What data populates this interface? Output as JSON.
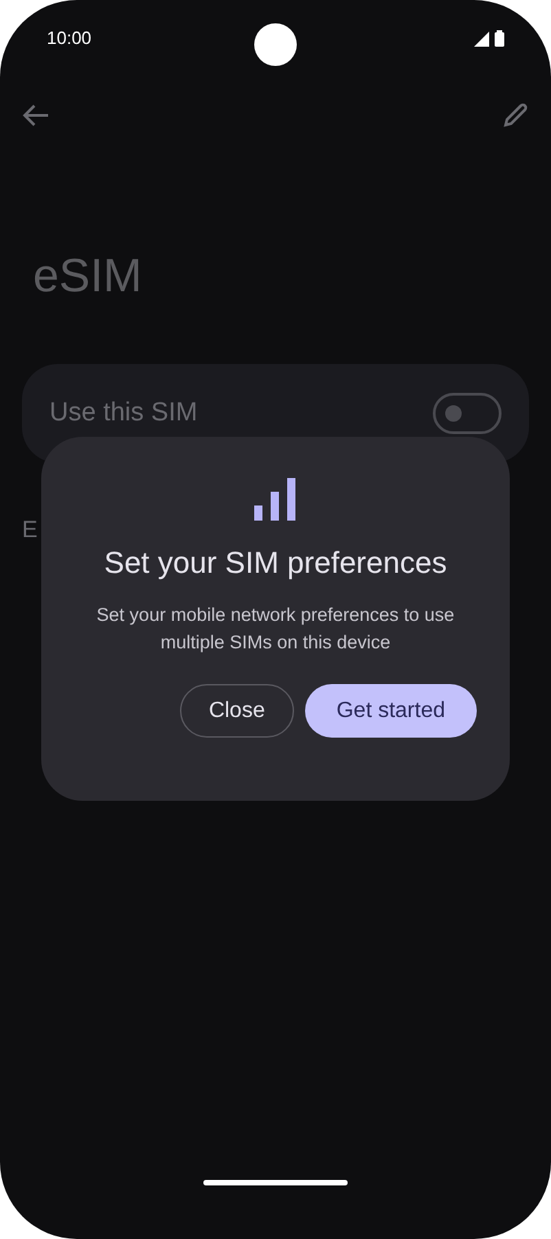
{
  "status_bar": {
    "time": "10:00"
  },
  "page": {
    "title": "eSIM"
  },
  "setting": {
    "label": "Use this SIM",
    "on": false
  },
  "next_item": {
    "label": "E"
  },
  "dialog": {
    "title": "Set your SIM preferences",
    "message": "Set your mobile network preferences to use multiple SIMs on this device",
    "buttons": [
      {
        "label": "Close",
        "kind": "outline"
      },
      {
        "label": "Get started",
        "kind": "filled"
      }
    ]
  }
}
